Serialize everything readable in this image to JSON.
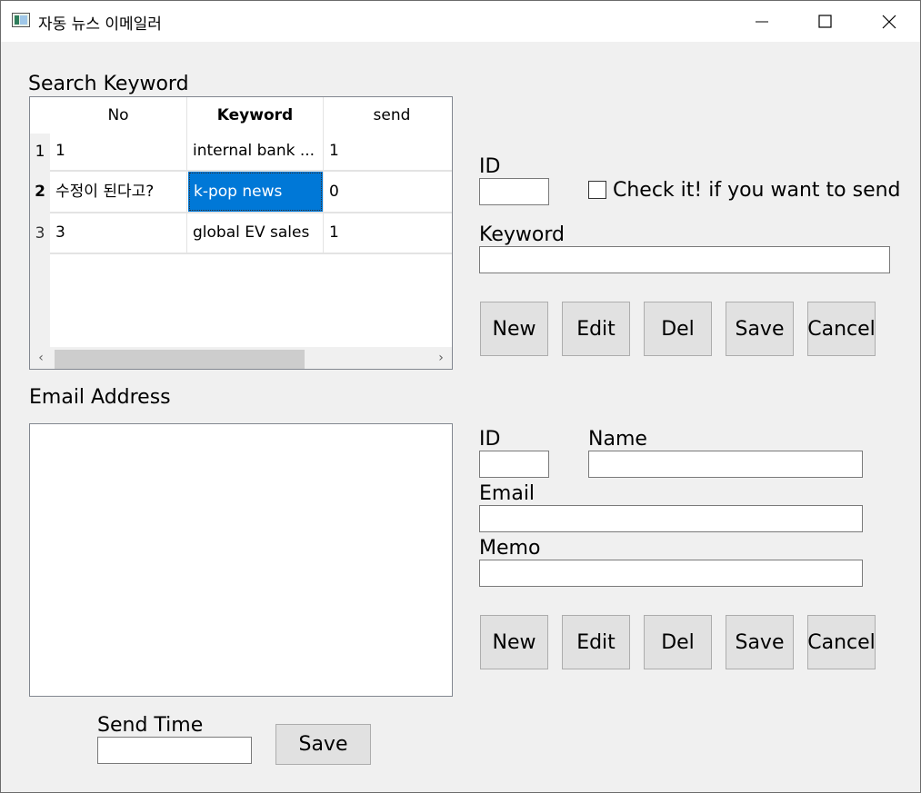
{
  "window": {
    "title": "자동 뉴스 이메일러"
  },
  "keyword_section": {
    "heading": "Search Keyword",
    "grid": {
      "columns": [
        "No",
        "Keyword",
        "send"
      ],
      "rows": [
        {
          "row_header": "1",
          "no": "1",
          "keyword": "internal bank ...",
          "send": "1"
        },
        {
          "row_header": "2",
          "no": "수정이 된다고?",
          "keyword": "k-pop news",
          "send": "0"
        },
        {
          "row_header": "3",
          "no": "3",
          "keyword": "global EV sales",
          "send": "1"
        }
      ],
      "selected_row": 2
    },
    "form": {
      "id_label": "ID",
      "id_value": "",
      "send_checkbox_label": "Check it! if you want to send",
      "send_checked": false,
      "keyword_label": "Keyword",
      "keyword_value": ""
    },
    "buttons": {
      "new": "New",
      "edit": "Edit",
      "del": "Del",
      "save": "Save",
      "cancel": "Cancel"
    }
  },
  "email_section": {
    "heading": "Email Address",
    "list_items": [],
    "form": {
      "id_label": "ID",
      "id_value": "",
      "name_label": "Name",
      "name_value": "",
      "email_label": "Email",
      "email_value": "",
      "memo_label": "Memo",
      "memo_value": ""
    },
    "buttons": {
      "new": "New",
      "edit": "Edit",
      "del": "Del",
      "save": "Save",
      "cancel": "Cancel"
    }
  },
  "send_time": {
    "label": "Send Time",
    "value": "",
    "save_label": "Save"
  },
  "colors": {
    "selection": "#0078d7",
    "button_face": "#e1e1e1",
    "window_bg": "#f0f0f0"
  }
}
